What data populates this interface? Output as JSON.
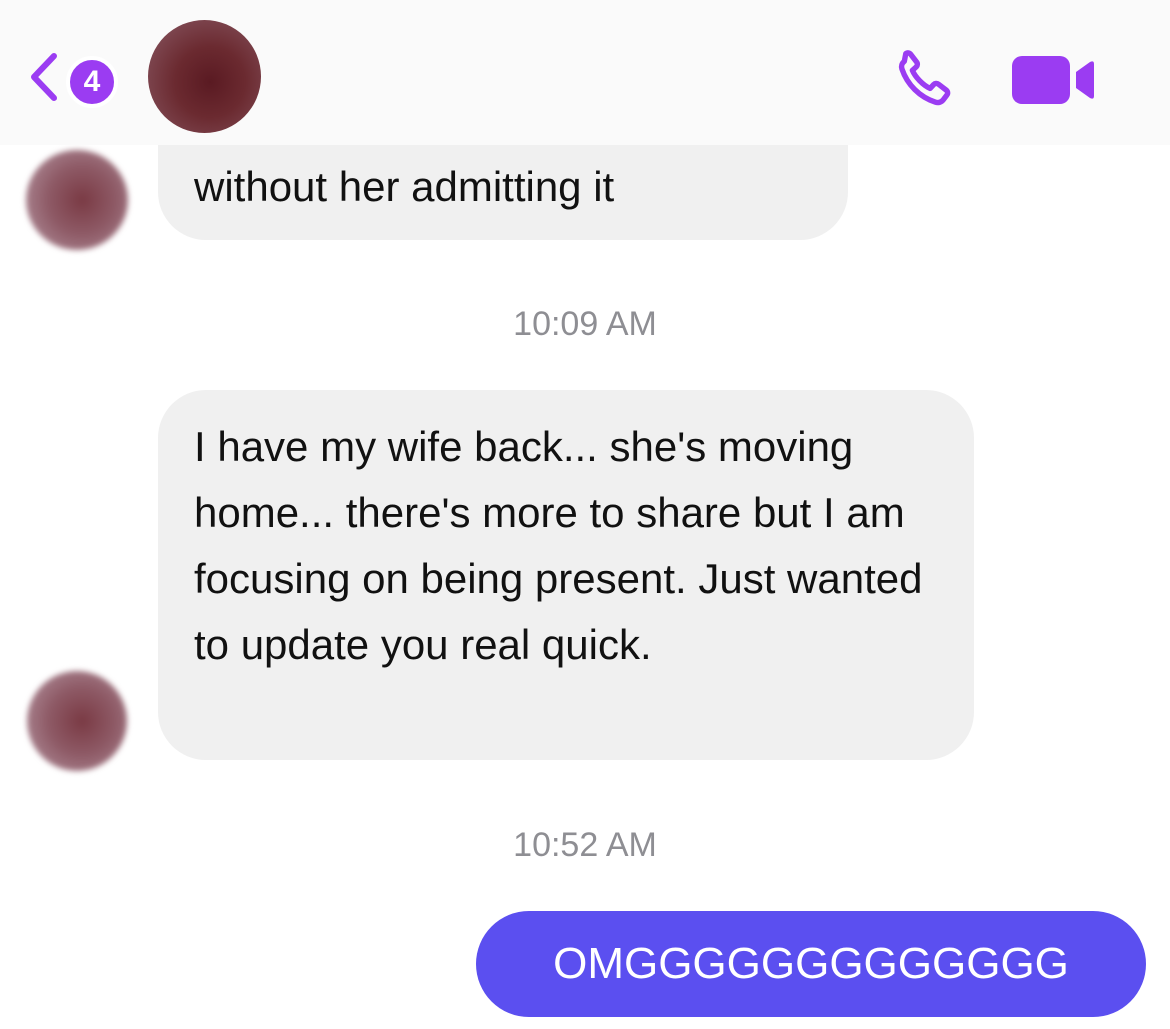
{
  "header": {
    "unread_count": "4",
    "colors": {
      "accent": "#9b3cf2",
      "outgoing_bubble": "#5b4ff0",
      "incoming_bubble": "#f0f0f0"
    },
    "icons": {
      "back": "chevron-left-icon",
      "call": "phone-icon",
      "video": "video-camera-icon"
    }
  },
  "messages": [
    {
      "direction": "incoming",
      "text": "without her admitting it"
    },
    {
      "timestamp": "10:09 AM"
    },
    {
      "direction": "incoming",
      "text": "I have my wife back... she's moving home... there's more to share but I am focusing on being present. Just wanted to update you real quick."
    },
    {
      "timestamp": "10:52 AM"
    },
    {
      "direction": "outgoing",
      "text": "OMGGGGGGGGGGGGG"
    }
  ]
}
